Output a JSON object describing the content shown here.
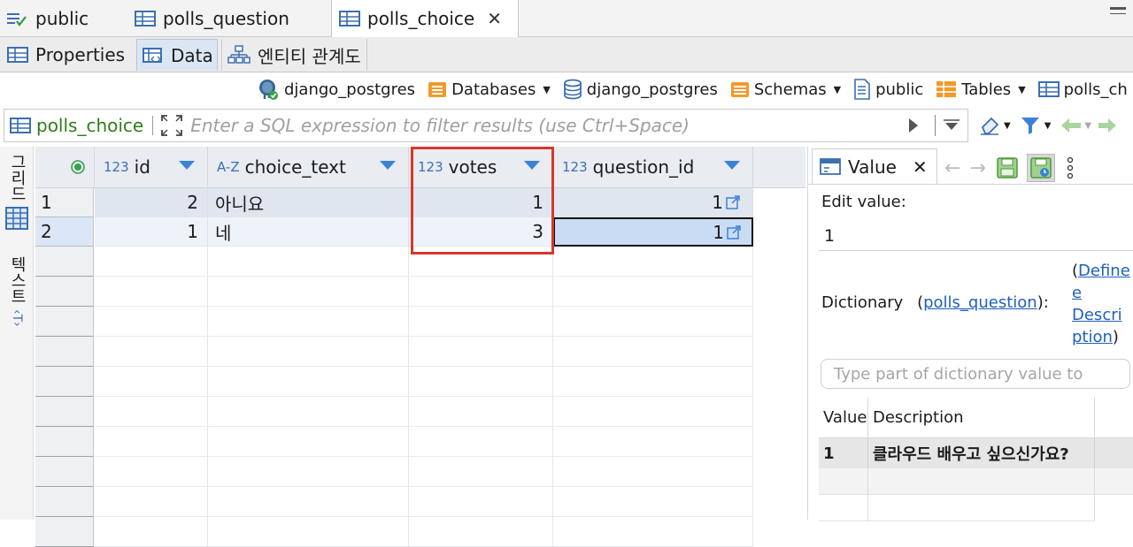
{
  "tabs": [
    {
      "label": "public",
      "icon": "schema-icon"
    },
    {
      "label": "polls_question",
      "icon": "table-icon"
    },
    {
      "label": "polls_choice",
      "icon": "table-icon",
      "active": true
    }
  ],
  "subtabs": [
    {
      "label": "Properties",
      "icon": "table-icon"
    },
    {
      "label": "Data",
      "icon": "data-table-icon",
      "active": true
    },
    {
      "label": "엔티티 관계도",
      "icon": "er-diagram-icon"
    }
  ],
  "breadcrumb": [
    {
      "label": "django_postgres",
      "icon": "postgres-elephant-icon",
      "dropdown": false
    },
    {
      "label": "Databases",
      "icon": "folder-icon",
      "dropdown": true
    },
    {
      "label": "django_postgres",
      "icon": "database-icon",
      "dropdown": false
    },
    {
      "label": "Schemas",
      "icon": "folder-icon",
      "dropdown": true
    },
    {
      "label": "public",
      "icon": "schema-icon",
      "dropdown": false
    },
    {
      "label": "Tables",
      "icon": "folder-icon",
      "dropdown": true
    },
    {
      "label": "polls_ch",
      "icon": "table-icon",
      "dropdown": false
    }
  ],
  "filter": {
    "table": "polls_choice",
    "placeholder": "Enter a SQL expression to filter results (use Ctrl+Space)"
  },
  "side_switcher": {
    "grid_label": "그리드",
    "text_label": "텍스트"
  },
  "grid": {
    "columns": [
      {
        "type": "123",
        "name": "id"
      },
      {
        "type": "A-Z",
        "name": "choice_text"
      },
      {
        "type": "123",
        "name": "votes"
      },
      {
        "type": "123",
        "name": "question_id"
      }
    ],
    "rows": [
      {
        "num": "1",
        "id": "2",
        "choice_text": "아니요",
        "votes": "1",
        "question_id": "1"
      },
      {
        "num": "2",
        "id": "1",
        "choice_text": "네",
        "votes": "3",
        "question_id": "1"
      }
    ]
  },
  "value_panel": {
    "tab_label": "Value",
    "edit_label": "Edit value:",
    "edit_value": "1",
    "dictionary_label": "Dictionary",
    "dictionary_link": "polls_question",
    "define_line1": "Define",
    "define_line2": "e",
    "define_line3": "Descri",
    "define_line4": "ption",
    "search_placeholder": "Type part of dictionary value to",
    "table_headers": [
      "Value",
      "Description"
    ],
    "table_rows": [
      {
        "value": "1",
        "description": "클라우드 배우고 싶으신가요?"
      }
    ]
  },
  "colors": {
    "accent": "#3b82d6",
    "highlight": "#d9372b",
    "selection": "#c9dcf4",
    "filter_table": "#2f7d1b",
    "link": "#1f5fbf"
  }
}
